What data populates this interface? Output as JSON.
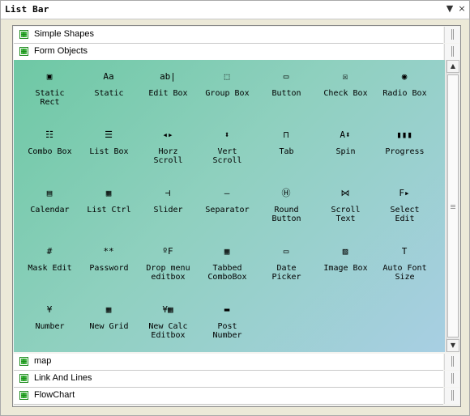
{
  "window": {
    "title": "List Bar",
    "pin_label": "▼",
    "close_label": "×"
  },
  "sections_top": [
    {
      "label": "Simple Shapes"
    },
    {
      "label": "Form Objects"
    }
  ],
  "items": [
    {
      "label": "Static\nRect",
      "icon": "static-rect-icon",
      "glyph": "▣"
    },
    {
      "label": "Static",
      "icon": "static-text-icon",
      "glyph": "Aa"
    },
    {
      "label": "Edit Box",
      "icon": "edit-box-icon",
      "glyph": "ab|"
    },
    {
      "label": "Group Box",
      "icon": "group-box-icon",
      "glyph": "⬚"
    },
    {
      "label": "Button",
      "icon": "button-icon",
      "glyph": "▭"
    },
    {
      "label": "Check Box",
      "icon": "check-box-icon",
      "glyph": "☒"
    },
    {
      "label": "Radio Box",
      "icon": "radio-box-icon",
      "glyph": "◉"
    },
    {
      "label": "Combo Box",
      "icon": "combo-box-icon",
      "glyph": "☷"
    },
    {
      "label": "List Box",
      "icon": "list-box-icon",
      "glyph": "☰"
    },
    {
      "label": "Horz\nScroll",
      "icon": "horz-scroll-icon",
      "glyph": "◂▸"
    },
    {
      "label": "Vert\nScroll",
      "icon": "vert-scroll-icon",
      "glyph": "⬍"
    },
    {
      "label": "Tab",
      "icon": "tab-icon",
      "glyph": "⊓"
    },
    {
      "label": "Spin",
      "icon": "spin-icon",
      "glyph": "A⬍"
    },
    {
      "label": "Progress",
      "icon": "progress-icon",
      "glyph": "▮▮▮"
    },
    {
      "label": "Calendar",
      "icon": "calendar-icon",
      "glyph": "▤"
    },
    {
      "label": "List Ctrl",
      "icon": "list-ctrl-icon",
      "glyph": "▦"
    },
    {
      "label": "Slider",
      "icon": "slider-icon",
      "glyph": "⊣"
    },
    {
      "label": "Separator",
      "icon": "separator-icon",
      "glyph": "—"
    },
    {
      "label": "Round\nButton",
      "icon": "round-button-icon",
      "glyph": "Ⓗ"
    },
    {
      "label": "Scroll\nText",
      "icon": "scroll-text-icon",
      "glyph": "⋈"
    },
    {
      "label": "Select\nEdit",
      "icon": "select-edit-icon",
      "glyph": "F▸"
    },
    {
      "label": "Mask Edit",
      "icon": "mask-edit-icon",
      "glyph": "#"
    },
    {
      "label": "Password",
      "icon": "password-icon",
      "glyph": "**"
    },
    {
      "label": "Drop menu\neditbox",
      "icon": "drop-menu-editbox-icon",
      "glyph": "ºF"
    },
    {
      "label": "Tabbed\nComboBox",
      "icon": "tabbed-combobox-icon",
      "glyph": "▦"
    },
    {
      "label": "Date\nPicker",
      "icon": "date-picker-icon",
      "glyph": "▭"
    },
    {
      "label": "Image Box",
      "icon": "image-box-icon",
      "glyph": "▨"
    },
    {
      "label": "Auto Font\nSize",
      "icon": "auto-font-size-icon",
      "glyph": "T"
    },
    {
      "label": "Number",
      "icon": "number-icon",
      "glyph": "¥"
    },
    {
      "label": "New Grid",
      "icon": "new-grid-icon",
      "glyph": "▦"
    },
    {
      "label": "New Calc\nEditbox",
      "icon": "new-calc-editbox-icon",
      "glyph": "¥▦"
    },
    {
      "label": "Post\nNumber",
      "icon": "post-number-icon",
      "glyph": "▬"
    }
  ],
  "sections_bottom": [
    {
      "label": "map"
    },
    {
      "label": "Link And Lines"
    },
    {
      "label": "FlowChart"
    }
  ],
  "colors": {
    "accent_green": "#1d8a1d",
    "gradient_start": "#6ec8a4",
    "gradient_end": "#a8cfe3"
  }
}
